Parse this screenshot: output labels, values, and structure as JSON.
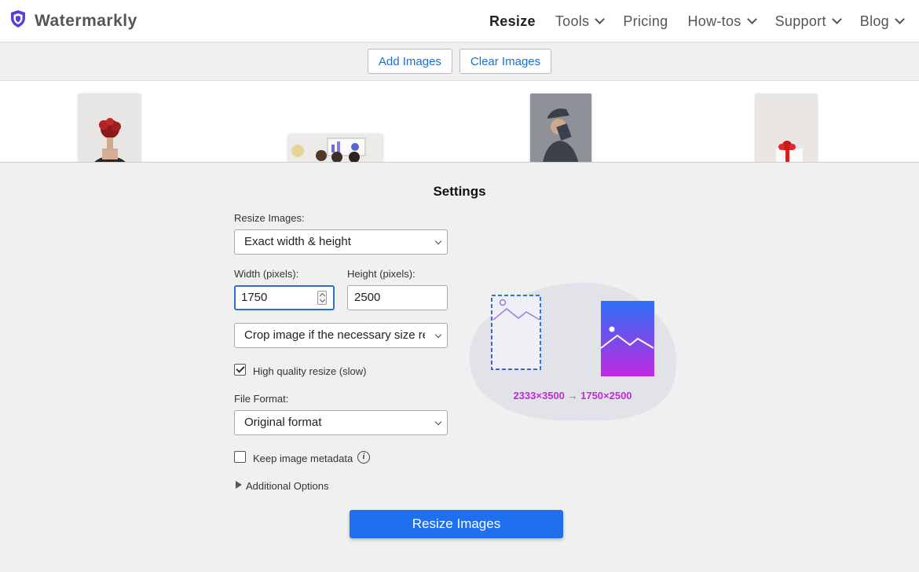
{
  "header": {
    "brand": "Watermarkly",
    "nav": [
      {
        "label": "Resize",
        "active": true,
        "dropdown": false
      },
      {
        "label": "Tools",
        "dropdown": true
      },
      {
        "label": "Pricing",
        "dropdown": false
      },
      {
        "label": "How-tos",
        "dropdown": true
      },
      {
        "label": "Support",
        "dropdown": true
      },
      {
        "label": "Blog",
        "dropdown": true
      }
    ]
  },
  "toolbar": {
    "add_images": "Add Images",
    "clear_images": "Clear Images"
  },
  "settings": {
    "title": "Settings",
    "resize_label": "Resize Images:",
    "resize_value": "Exact width & height",
    "width_label": "Width (pixels):",
    "width_value": "1750",
    "height_label": "Height (pixels):",
    "height_value": "2500",
    "crop_value": "Crop image if the necessary size requires it",
    "hq_label": "High quality resize (slow)",
    "hq_checked": true,
    "format_label": "File Format:",
    "format_value": "Original format",
    "metadata_label": "Keep image metadata",
    "metadata_checked": false,
    "additional_options": "Additional Options",
    "resize_button": "Resize Images"
  },
  "illustration": {
    "caption": "2333×3500 → 1750×2500"
  },
  "colors": {
    "accent": "#1f6ff0",
    "link": "#1a6fd1",
    "caption": "#c22ad8"
  }
}
